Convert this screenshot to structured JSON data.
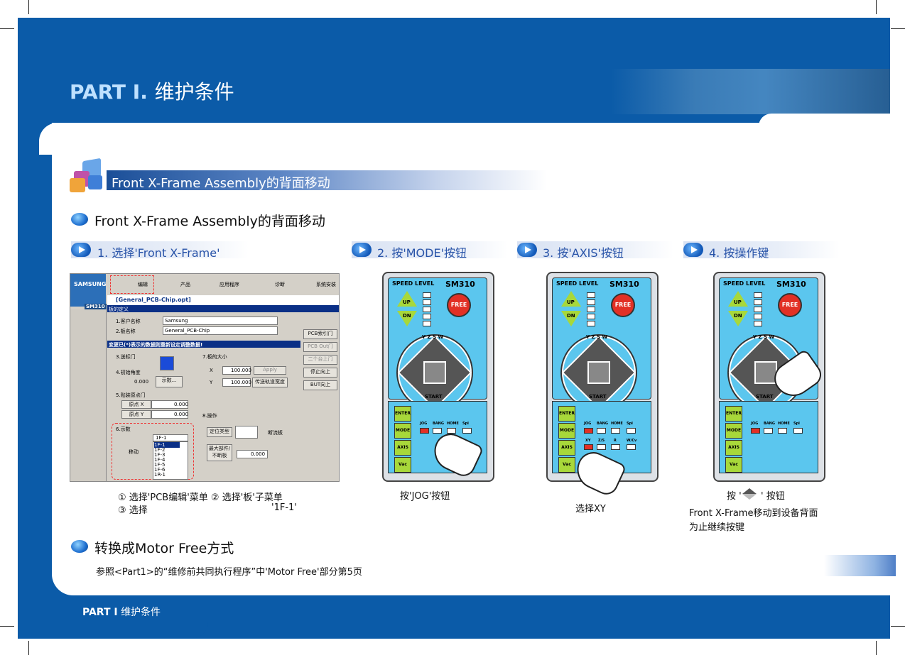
{
  "header": {
    "title_part": "PART I.",
    "title_cn": "维护条件"
  },
  "footer": {
    "part": "PART I",
    "label": "维护条件"
  },
  "section": {
    "title": "Front X-Frame Assembly的背面移动"
  },
  "sub1": {
    "title": "Front X-Frame Assembly的背面移动"
  },
  "steps": [
    {
      "label": "1.  选择'Front X-Frame'"
    },
    {
      "label": "2. 按'MODE'按钮"
    },
    {
      "label": "3. 按'AXIS'按钮"
    },
    {
      "label": "4.  按操作键"
    }
  ],
  "software": {
    "menu": [
      "编辑",
      "产品",
      "应用程序",
      "诊断",
      "系统安装"
    ],
    "file_title": "[General_PCB-Chip.opt]",
    "panel_title": "板的定义",
    "customer_label": "1.客户名称",
    "customer_value": "Samsung",
    "board_label": "2.板名称",
    "board_value": "General_PCB-Chip",
    "warning": "变更已(*)表示的数据则重新设定调整数据!",
    "conveyor_label": "3.送标门",
    "size_label": "7.板的大小",
    "x_label": "X",
    "x_value": "100.000",
    "y_label": "Y",
    "y_value": "100.000",
    "apply": "Apply",
    "change_width": "传送轨道宽度",
    "angle_label": "4.初始角度",
    "angle_value": "0.000",
    "show_btn": "示数...",
    "origin_label": "5.贴装原点门",
    "origin_x": "原点 X",
    "origin_x_value": "0.000",
    "origin_y": "原点 Y",
    "origin_y_value": "0.000",
    "ops_label": "8.操作",
    "locate_type": "定位类型",
    "stop_check": "断流板",
    "max_label": "最大部件/不断板",
    "max_value": "0.000",
    "side_buttons": [
      "PCB索引门",
      "PCB Out门",
      "二个台上门",
      "停止向上",
      "BUT向上"
    ],
    "count_label": "6.示数",
    "move_label": "移动",
    "list_items": [
      "1F-1",
      "1F-2",
      "1F-3",
      "1F-4",
      "1F-5",
      "1F-6",
      "1R-1"
    ],
    "select_value": "1F-1",
    "logo": "SAMSUNG",
    "model": "SM310"
  },
  "remote": {
    "speed": "SPEED  LEVEL",
    "model": "SM310",
    "free": "FREE",
    "up": "UP",
    "dn": "DN",
    "axes": "Y  Z  S  W",
    "start": "START",
    "keys": [
      "ENTER",
      "MODE",
      "AXIS",
      "Vac"
    ],
    "modes": [
      "JOG",
      "BANG",
      "HOME",
      "Spl"
    ],
    "axes_row": [
      "XY",
      "Z/S",
      "R",
      "W/Cv"
    ]
  },
  "captions": {
    "c1_line1": "① 选择'PCB编辑'菜单 ② 选择'板'子菜单",
    "c1_line2a": "③ 选择",
    "c1_line2b": "'1F-1'",
    "c2": "按'JOG'按钮",
    "c3": "选择XY",
    "c4a": "按 '",
    "c4b": "' 按钮",
    "c4_line2": "Front X-Frame移动到设备背面",
    "c4_line3": "为止继续按键"
  },
  "sub2": {
    "title": "转换成Motor Free方式",
    "text": "参照<Part1>的“维修前共同执行程序”中'Motor Free'部分第5页"
  }
}
